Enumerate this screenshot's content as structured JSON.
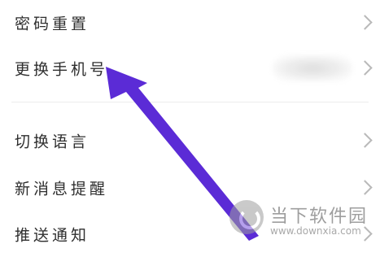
{
  "settings": {
    "group1": [
      {
        "label": "密码重置"
      },
      {
        "label": "更换手机号"
      }
    ],
    "group2": [
      {
        "label": "切换语言"
      },
      {
        "label": "新消息提醒"
      },
      {
        "label": "推送通知"
      }
    ]
  },
  "annotation": {
    "color": "#5b2bd6"
  },
  "watermark": {
    "name": "当下软件园",
    "url": "www.downxia.com"
  }
}
